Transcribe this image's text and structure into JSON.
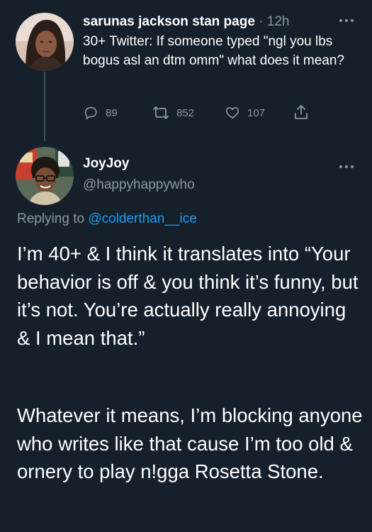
{
  "tweet1": {
    "author_name": "sarunas jackson stan page",
    "separator": "·",
    "time": "12h",
    "text": "30+ Twitter: If someone typed \"ngl you lbs bogus asl an dtm omm\" what does it mean?",
    "reply_count": "89",
    "retweet_count": "852",
    "like_count": "107"
  },
  "tweet2": {
    "author_name": "JoyJoy",
    "handle": "@happyhappywho",
    "replying_prefix": "Replying to",
    "replying_to": "@colderthan__ice",
    "paragraph1": "I’m 40+ & I think it translates into “Your behavior is off & you think it’s funny, but it’s not. You’re actually really annoying & I mean that.”",
    "paragraph2": "Whatever it means, I’m blocking anyone who writes like that cause I’m too old & ornery to play n!gga Rosetta Stone."
  },
  "icons": {
    "more": "more-horizontal-icon",
    "reply": "reply-icon",
    "retweet": "retweet-icon",
    "like": "heart-icon",
    "share": "share-icon"
  },
  "colors": {
    "background": "#15202b",
    "text": "#ffffff",
    "muted": "#8b98a5",
    "link": "#1d9bf0",
    "thread_line": "#3d5466"
  }
}
